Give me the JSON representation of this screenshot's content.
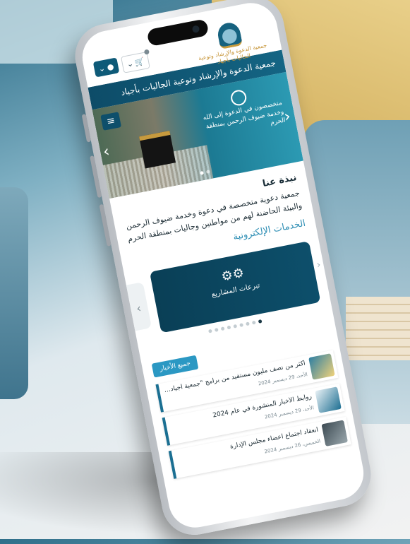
{
  "header": {
    "org_name": "جمعية الدعوة والإرشاد وتوعية الجاليات بأجياد",
    "logo_text": "جمعية الدعوة والإرشاد وتوعية الجاليات بأجياد"
  },
  "slider": {
    "headline": "متخصصون في الدعوة إلى الله وخدمة ضيوف الرحمن بمنطقة الحرم",
    "arrow_left": "‹",
    "arrow_right": "›"
  },
  "about": {
    "heading": "نبذة عنا",
    "text": "جمعية دعوية متخصصة في دعوة وخدمة ضيوف الرحمن والبيئة الحاضنة لهم من مواطنين وجاليات بمنطقة الحرم"
  },
  "services": {
    "title": "الخدمات الإلكترونية",
    "card_label": "تبرعات المشاريع",
    "prev": "‹",
    "next": "›"
  },
  "news": {
    "button": "جميع الأخبار",
    "items": [
      {
        "title": "أكثر من نصف مليون مستفيد من برامج \"جمعية أجياد للدعوة...",
        "date": "الأحد، 29 ديسمبر 2024"
      },
      {
        "title": "روابط الأخبار المنشورة في عام 2024",
        "date": "الأحد، 29 ديسمبر 2024"
      },
      {
        "title": "انعقاد اجتماع أعضاء مجلس الإدارة",
        "date": "الخميس، 26 ديسمبر 2024"
      }
    ]
  },
  "colors": {
    "primary": "#0e5a78",
    "accent": "#2b98c3",
    "gold": "#c89b3c"
  }
}
